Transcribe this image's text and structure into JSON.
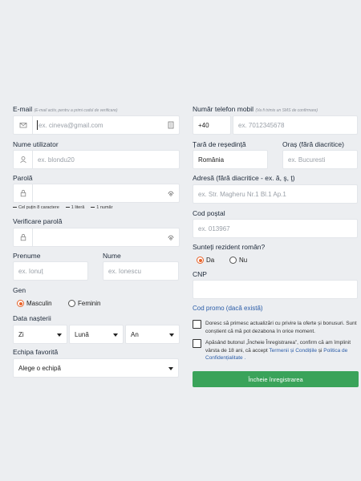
{
  "left": {
    "email": {
      "label": "E-mail",
      "hint": "(E-mail activ, pentru a primi codul de verificare)",
      "placeholder": "ex. cineva@gmail.com"
    },
    "username": {
      "label": "Nume utilizator",
      "placeholder": "ex. blondu20"
    },
    "password": {
      "label": "Parolă",
      "requirements": [
        "Cel puțin 8 caractere",
        "1 literă",
        "1 număr"
      ]
    },
    "password_confirm": {
      "label": "Verificare parolă"
    },
    "first_name": {
      "label": "Prenume",
      "placeholder": "ex. Ionuț"
    },
    "last_name": {
      "label": "Nume",
      "placeholder": "ex. Ionescu"
    },
    "gender": {
      "label": "Gen",
      "options": [
        "Masculin",
        "Feminin"
      ],
      "selected": "Masculin"
    },
    "birth": {
      "label": "Data nașterii",
      "day": "Zi",
      "month": "Lună",
      "year": "An"
    },
    "team": {
      "label": "Echipa favorită",
      "value": "Alege o echipă"
    }
  },
  "right": {
    "phone": {
      "label": "Număr telefon mobil",
      "hint": "(Va fi trimis un SMS de confirmare)",
      "prefix": "+40",
      "placeholder": "ex. 7012345678"
    },
    "country": {
      "label": "Țară de reședință",
      "value": "România"
    },
    "city": {
      "label": "Oraș (fără diacritice)",
      "placeholder": "ex. Bucuresti"
    },
    "address": {
      "label": "Adresă (fără diacritice - ex. ă, ş, ţ)",
      "placeholder": "ex. Str. Magheru Nr.1 Bl.1 Ap.1"
    },
    "postal": {
      "label": "Cod poștal",
      "placeholder": "ex. 013967"
    },
    "resident": {
      "label": "Sunteți rezident român?",
      "options": [
        "Da",
        "Nu"
      ],
      "selected": "Da"
    },
    "cnp": {
      "label": "CNP"
    },
    "promo": {
      "label": "Cod promo (dacă există)"
    },
    "consent_updates": "Doresc să primesc actualizări cu privire la oferte și bonusuri. Sunt conștient că mă pot dezabona în orice moment.",
    "consent_terms": {
      "text_before": "Apăsând butonul „Încheie Înregistrarea”, confirm că am împlinit vârsta de 18 ani, că accept ",
      "terms_link": "Termenii și Condițiile",
      "and": " și ",
      "privacy_link": "Politica de Confidențialitate",
      "end": " ."
    },
    "submit": "Încheie înregistrarea"
  },
  "colors": {
    "accent": "#e8632a",
    "submit": "#3aa35a",
    "link": "#2a5ca8",
    "background": "#eceef1"
  },
  "icons": [
    "envelope-icon",
    "contact-card-icon",
    "user-icon",
    "lock-icon",
    "fingerprint-icon",
    "chevron-down-icon"
  ]
}
